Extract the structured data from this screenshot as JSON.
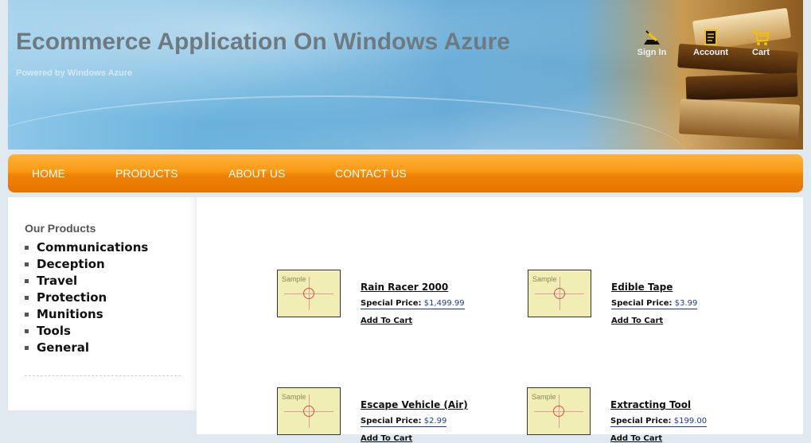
{
  "header": {
    "title": "Ecommerce Application On Windows Azure",
    "subtitle": "Powered by Windows Azure",
    "links": [
      {
        "label": "Sign In",
        "icon": "sign-in-pen-icon"
      },
      {
        "label": "Account",
        "icon": "account-document-icon"
      },
      {
        "label": "Cart",
        "icon": "shopping-cart-icon"
      }
    ]
  },
  "nav": {
    "items": [
      "HOME",
      "PRODUCTS",
      "ABOUT US",
      "CONTACT US"
    ]
  },
  "sidebar": {
    "title": "Our Products",
    "categories": [
      "Communications",
      "Deception",
      "Travel",
      "Protection",
      "Munitions",
      "Tools",
      "General"
    ]
  },
  "products": [
    {
      "name": "Rain Racer 2000",
      "price_label": "Special Price:",
      "price": "$1,499.99",
      "add_label": "Add To Cart",
      "image_text": "Sample"
    },
    {
      "name": "Edible Tape",
      "price_label": "Special Price:",
      "price": "$3.99",
      "add_label": "Add To Cart",
      "image_text": "Sample"
    },
    {
      "name": "Escape Vehicle (Air)",
      "price_label": "Special Price:",
      "price": "$2.99",
      "add_label": "Add To Cart",
      "image_text": "Sample"
    },
    {
      "name": "Extracting Tool",
      "price_label": "Special Price:",
      "price": "$199.00",
      "add_label": "Add To Cart",
      "image_text": "Sample"
    }
  ],
  "colors": {
    "nav_orange": "#f79a13",
    "title_gray": "#6e7a82",
    "price_blue": "#1a3a9a"
  }
}
